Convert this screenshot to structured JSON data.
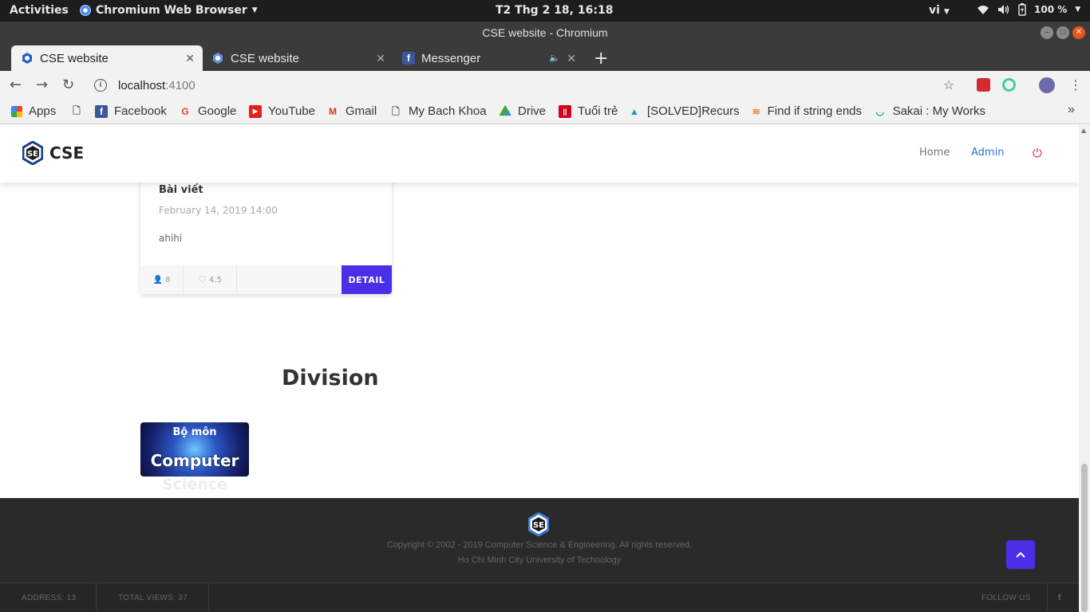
{
  "system": {
    "activities": "Activities",
    "app_name": "Chromium Web Browser",
    "clock": "T2 Thg 2 18, 16:18",
    "lang": "vi",
    "battery": "100 %"
  },
  "window": {
    "title": "CSE website - Chromium"
  },
  "tabs": [
    {
      "label": "CSE website",
      "active": true
    },
    {
      "label": "CSE website",
      "active": false
    },
    {
      "label": "Messenger",
      "active": false
    }
  ],
  "toolbar": {
    "url_host": "localhost",
    "url_port": ":4100"
  },
  "bookmarks": [
    {
      "label": "Apps",
      "icon": "apps-grid-icon"
    },
    {
      "label": "Facebook",
      "icon": "facebook-icon"
    },
    {
      "label": "Google",
      "icon": "google-icon"
    },
    {
      "label": "YouTube",
      "icon": "youtube-icon"
    },
    {
      "label": "Gmail",
      "icon": "gmail-icon"
    },
    {
      "label": "My Bach Khoa",
      "icon": "page-icon"
    },
    {
      "label": "Drive",
      "icon": "drive-icon"
    },
    {
      "label": "Tuổi trẻ",
      "icon": "tuoitre-icon"
    },
    {
      "label": "[SOLVED]Recurs",
      "icon": "arch-icon"
    },
    {
      "label": "Find if string ends",
      "icon": "stackoverflow-icon"
    },
    {
      "label": "Sakai : My Works",
      "icon": "sakai-icon"
    }
  ],
  "site": {
    "brand": "CSE",
    "nav": {
      "home": "Home",
      "admin": "Admin"
    },
    "card": {
      "title": "Bài viết",
      "date": "February 14, 2019 14:00",
      "body": "ahihi",
      "views": "8",
      "rating": "4.5",
      "detail_label": "DETAIL"
    },
    "division": {
      "title": "Division",
      "item": {
        "line1": "Bộ môn",
        "line2": "Computer",
        "line3": "Science"
      }
    },
    "footer": {
      "copyright": "Copyright © 2002 - 2019 Computer Science & Engineering. All rights reserved.",
      "university": "Ho Chi Minh City University of Technology",
      "address": "ADDRESS: 13",
      "total_views": "TOTAL VIEWS: 37",
      "follow": "FOLLOW US"
    }
  },
  "colors": {
    "accent": "#4a2fe8",
    "admin_link": "#2f6fdd",
    "power": "#e0245e",
    "footer_bg": "#2a2a2a"
  }
}
